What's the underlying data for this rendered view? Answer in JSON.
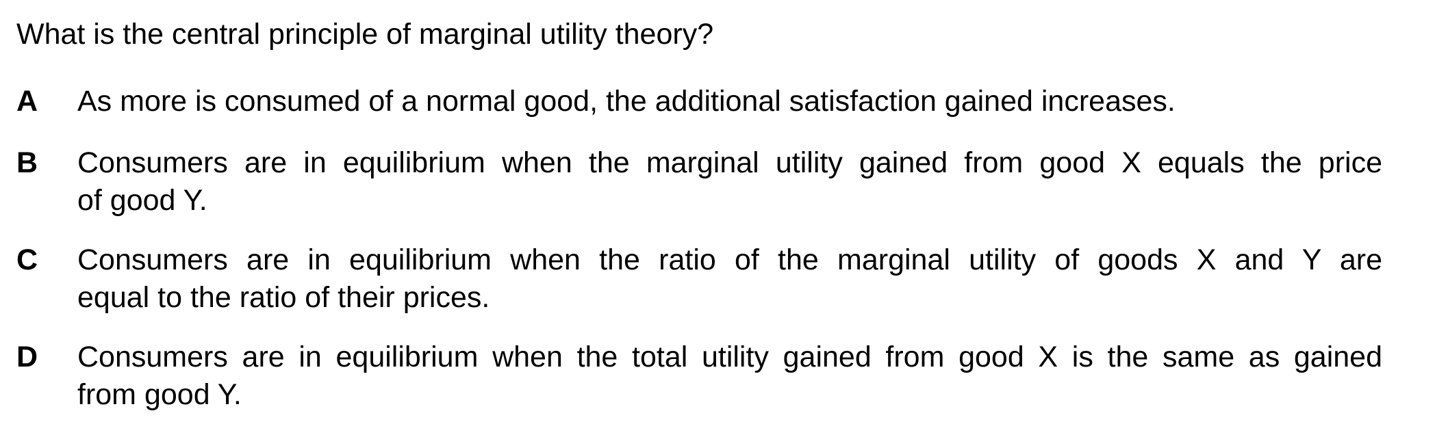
{
  "question": {
    "text": "What is the central principle of marginal utility theory?"
  },
  "options": [
    {
      "letter": "A",
      "lines": [
        "As more is consumed of a normal good, the additional satisfaction gained increases."
      ]
    },
    {
      "letter": "B",
      "lines": [
        "Consumers are in equilibrium when the marginal utility gained from good X equals the price",
        "of good Y."
      ]
    },
    {
      "letter": "C",
      "lines": [
        "Consumers are in equilibrium when the ratio of the marginal utility of goods X and Y are",
        "equal to the ratio of their prices."
      ]
    },
    {
      "letter": "D",
      "lines": [
        "Consumers are in equilibrium when the total utility gained from good X is the same as gained",
        "from good Y."
      ]
    }
  ]
}
